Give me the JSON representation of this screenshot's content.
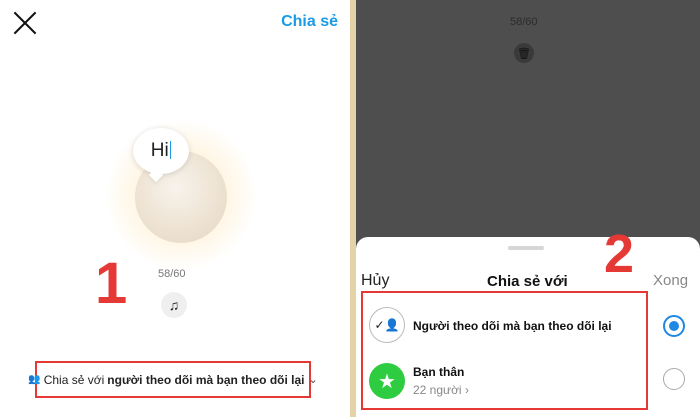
{
  "left": {
    "header": {
      "share_label": "Chia sẻ"
    },
    "note": {
      "text": "Hi"
    },
    "counter": "58/60",
    "icons": {
      "close": "close-icon",
      "music": "music-icon"
    },
    "step_marker": "1",
    "share_bar": {
      "prefix": "Chia sẻ với",
      "audience": "người theo dõi mà bạn theo dõi lại"
    }
  },
  "right": {
    "counter": "58/60",
    "icons": {
      "trash": "trash-icon"
    },
    "sheet": {
      "cancel_label": "Hủy",
      "title": "Chia sẻ với",
      "done_label": "Xong",
      "step_marker": "2",
      "options": [
        {
          "label": "Người theo dõi mà bạn theo dõi lại",
          "sub": "",
          "selected": true
        },
        {
          "label": "Bạn thân",
          "sub": "22 người",
          "selected": false
        }
      ]
    }
  },
  "colors": {
    "accent": "#1a9be6",
    "annotation_red": "#e53935",
    "close_friends_green": "#2ecc40"
  }
}
